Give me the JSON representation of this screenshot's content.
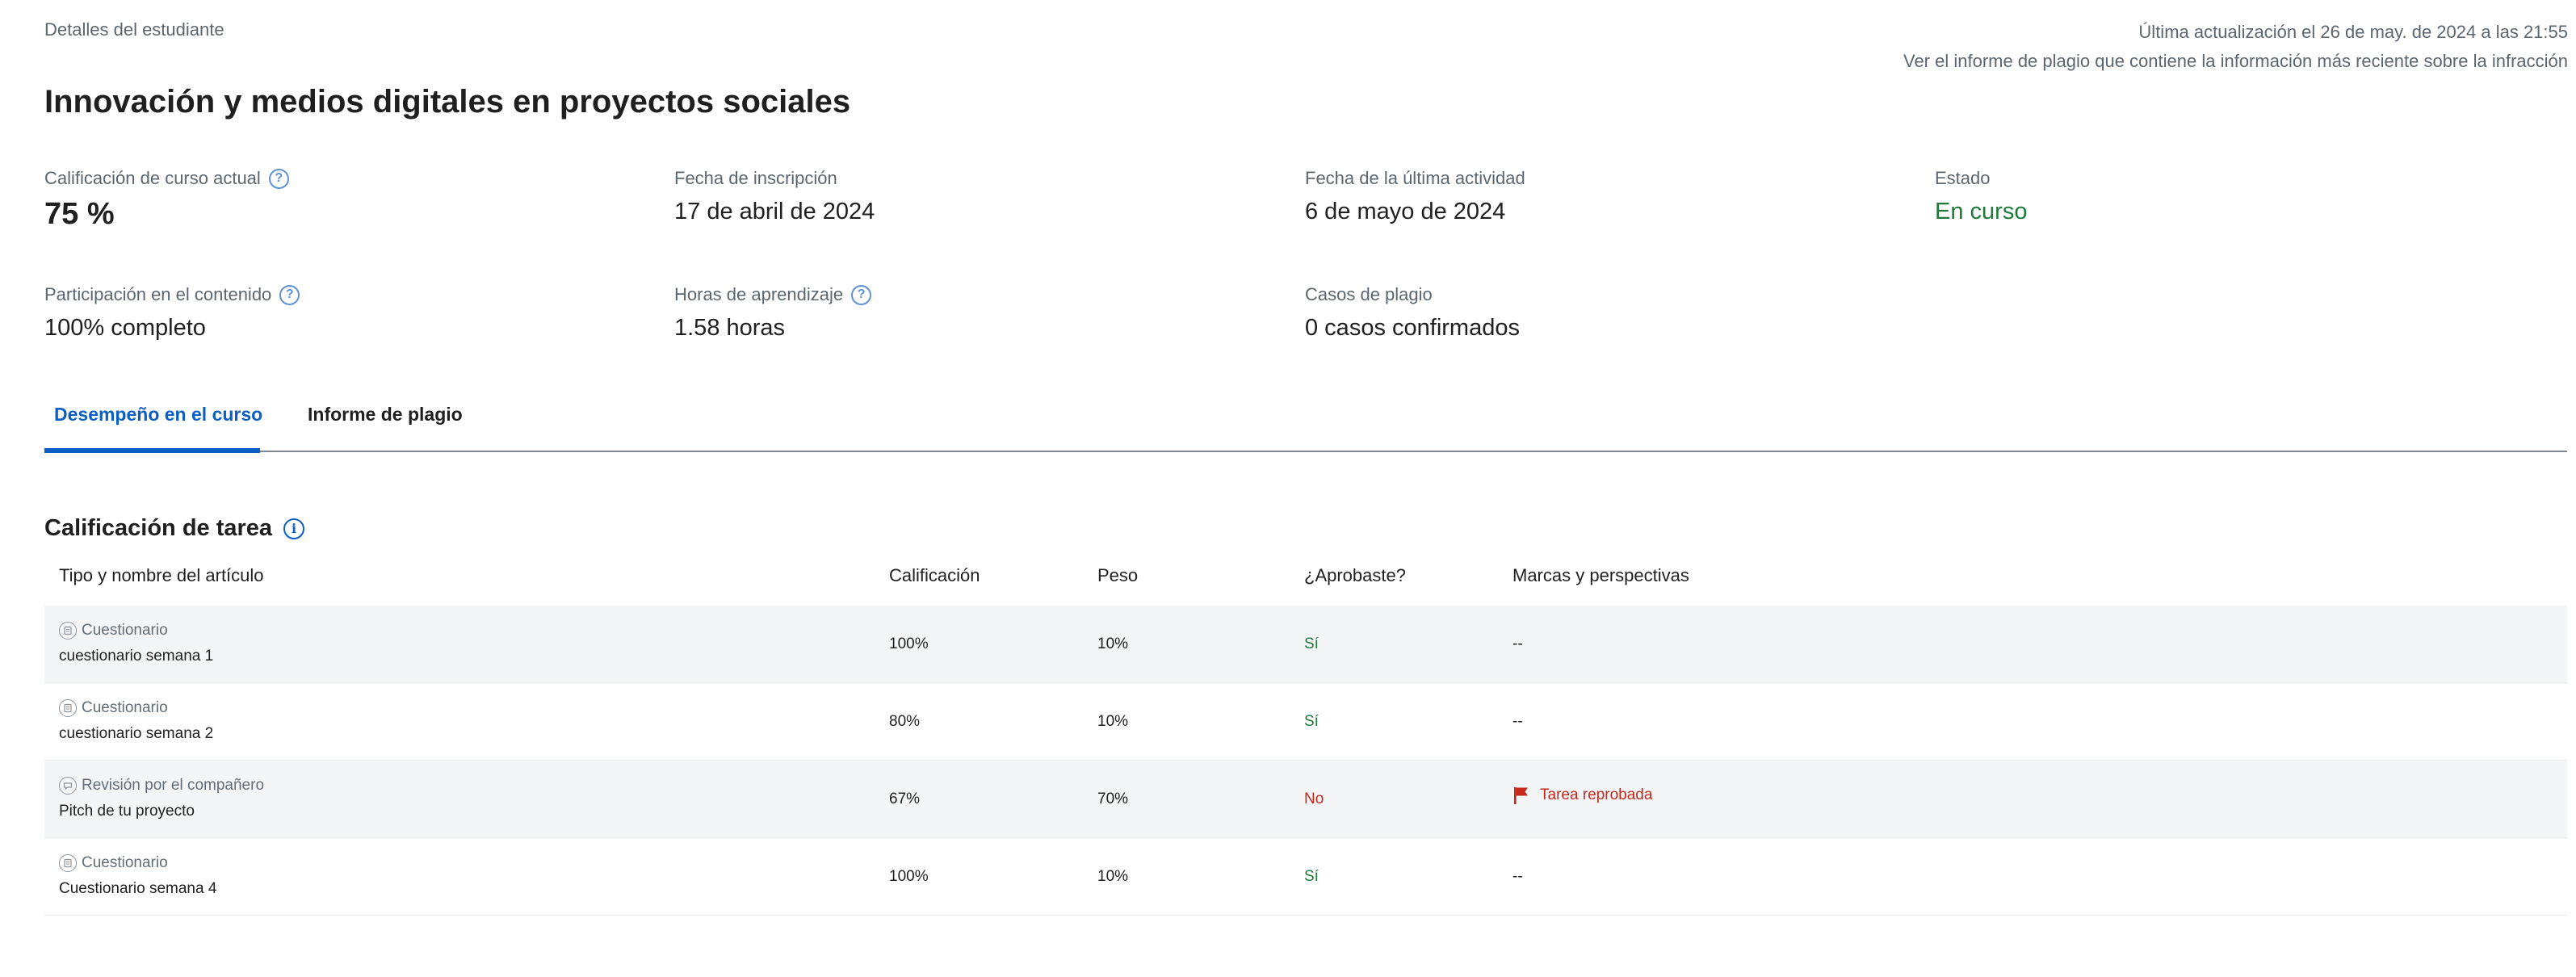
{
  "header": {
    "breadcrumb": "Detalles del estudiante",
    "last_update": "Última actualización el 26 de may. de 2024 a las 21:55",
    "plagiarism_link": "Ver el informe de plagio que contiene la información más reciente sobre la infracción"
  },
  "course": {
    "title": "Innovación y medios digitales en proyectos sociales"
  },
  "stats": {
    "grade": {
      "label": "Calificación de curso actual",
      "value": "75 %"
    },
    "enrollment": {
      "label": "Fecha de inscripción",
      "value": "17 de abril de 2024"
    },
    "last_activity": {
      "label": "Fecha de la última actividad",
      "value": "6 de mayo de 2024"
    },
    "status": {
      "label": "Estado",
      "value": "En curso",
      "color": "#1f7a3a"
    },
    "participation": {
      "label": "Participación en el contenido",
      "value": "100% completo"
    },
    "hours": {
      "label": "Horas de aprendizaje",
      "value": "1.58 horas"
    },
    "plagiarism": {
      "label": "Casos de plagio",
      "value": "0 casos confirmados"
    }
  },
  "tabs": [
    {
      "label": "Desempeño en el curso",
      "active": true
    },
    {
      "label": "Informe de plagio",
      "active": false
    }
  ],
  "section": {
    "title": "Calificación de tarea"
  },
  "table": {
    "headers": [
      "Tipo y nombre del artículo",
      "Calificación",
      "Peso",
      "¿Aprobaste?",
      "Marcas y perspectivas"
    ],
    "rows": [
      {
        "type": "Cuestionario",
        "type_icon": "quiz-icon",
        "name": "cuestionario semana 1",
        "grade": "100%",
        "weight": "10%",
        "passed": "Sí",
        "flags": "--"
      },
      {
        "type": "Cuestionario",
        "type_icon": "quiz-icon",
        "name": "cuestionario semana 2",
        "grade": "80%",
        "weight": "10%",
        "passed": "Sí",
        "flags": "--"
      },
      {
        "type": "Revisión por el compañero",
        "type_icon": "peer-review-icon",
        "name": "Pitch de tu proyecto",
        "grade": "67%",
        "weight": "70%",
        "passed": "No",
        "flags": "Tarea reprobada",
        "flag_icon": "flag-icon"
      },
      {
        "type": "Cuestionario",
        "type_icon": "quiz-icon",
        "name": "Cuestionario semana 4",
        "grade": "100%",
        "weight": "10%",
        "passed": "Sí",
        "flags": "--"
      }
    ]
  },
  "colors": {
    "accent": "#0b5ec2",
    "pass": "#1f7a3a",
    "fail": "#c4291c"
  }
}
